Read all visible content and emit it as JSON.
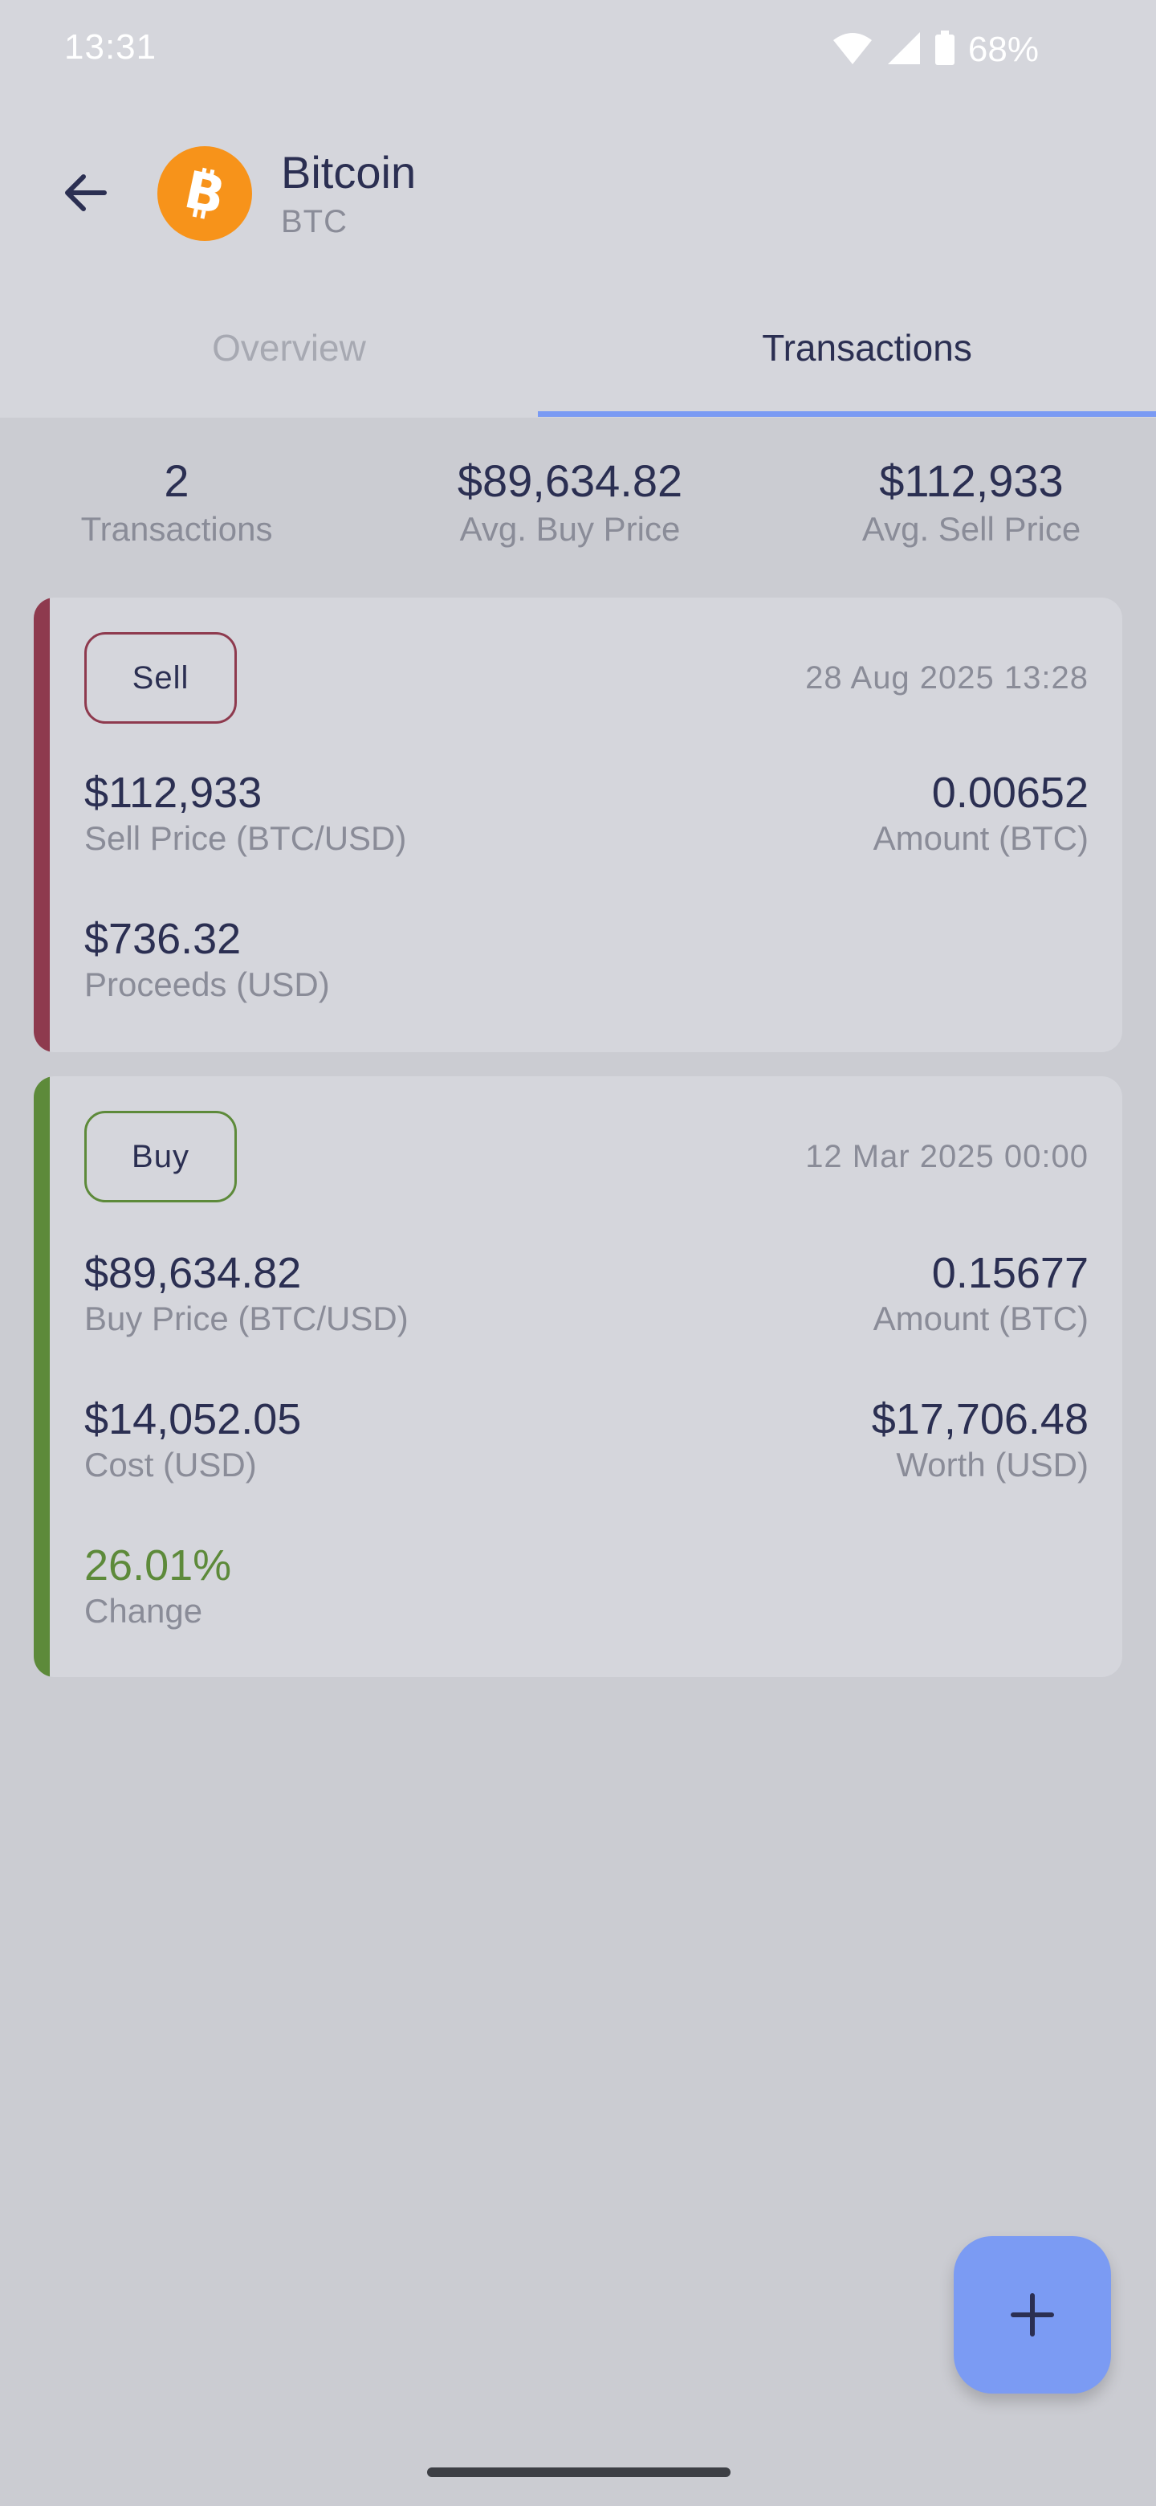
{
  "status_bar": {
    "time": "13:31",
    "battery": "68%",
    "icons": [
      "wifi-icon",
      "cellular-signal-icon",
      "battery-icon"
    ]
  },
  "header": {
    "back_icon": "arrow-left-icon",
    "coin_icon": "bitcoin-icon",
    "name": "Bitcoin",
    "symbol": "BTC"
  },
  "tabs": [
    {
      "label": "Overview",
      "selected": false
    },
    {
      "label": "Transactions",
      "selected": true
    }
  ],
  "summary": {
    "count": {
      "value": "2",
      "label": "Transactions"
    },
    "avg_buy": {
      "value": "$89,634.82",
      "label": "Avg. Buy Price"
    },
    "avg_sell": {
      "value": "$112,933",
      "label": "Avg. Sell Price"
    }
  },
  "transactions": [
    {
      "type": "Sell",
      "date": "28 Aug 2025 13:28",
      "price": {
        "value": "$112,933",
        "label": "Sell Price (BTC/USD)"
      },
      "amount": {
        "value": "0.00652",
        "label": "Amount (BTC)"
      },
      "proceeds": {
        "value": "$736.32",
        "label": "Proceeds (USD)"
      }
    },
    {
      "type": "Buy",
      "date": "12 Mar 2025 00:00",
      "price": {
        "value": "$89,634.82",
        "label": "Buy Price (BTC/USD)"
      },
      "amount": {
        "value": "0.15677",
        "label": "Amount (BTC)"
      },
      "cost": {
        "value": "$14,052.05",
        "label": "Cost (USD)"
      },
      "worth": {
        "value": "$17,706.48",
        "label": "Worth (USD)"
      },
      "change": {
        "value": "26.01%",
        "label": "Change"
      }
    }
  ],
  "fab": {
    "icon": "plus-icon"
  },
  "colors": {
    "accent": "#7a9af3",
    "sell": "#8e3a4e",
    "buy": "#5d8a3a",
    "bitcoin": "#f7931a",
    "text": "#2b2f52",
    "muted": "#8a8c98"
  }
}
